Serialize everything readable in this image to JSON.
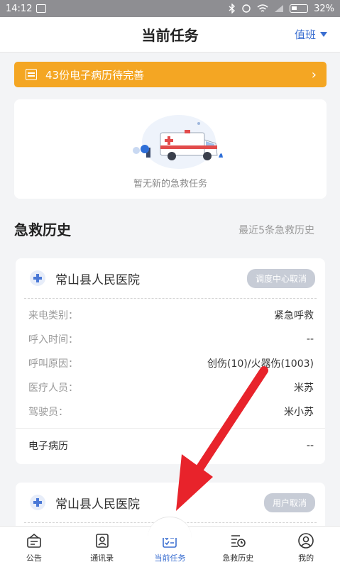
{
  "status_bar": {
    "time": "14:12",
    "battery": "32%"
  },
  "header": {
    "title": "当前任务",
    "duty_label": "值班"
  },
  "notice": {
    "text": "43份电子病历待完善"
  },
  "empty_state": {
    "text": "暂无新的急救任务"
  },
  "history": {
    "title": "急救历史",
    "subtitle": "最近5条急救历史",
    "records": [
      {
        "hospital": "常山县人民医院",
        "tag": "调度中心取消",
        "fields": [
          {
            "label": "来电类别：",
            "value": "紧急呼救"
          },
          {
            "label": "呼入时间：",
            "value": "--"
          },
          {
            "label": "呼叫原因：",
            "value": "创伤(10)/火器伤(1003)"
          },
          {
            "label": "医疗人员：",
            "value": "米苏"
          },
          {
            "label": "驾驶员：",
            "value": "米小苏"
          }
        ],
        "emr_label": "电子病历",
        "emr_value": "--"
      },
      {
        "hospital": "常山县人民医院",
        "tag": "用户取消"
      }
    ]
  },
  "tabbar": {
    "items": [
      {
        "label": "公告",
        "icon": "announcement-icon"
      },
      {
        "label": "通讯录",
        "icon": "contacts-icon"
      },
      {
        "label": "当前任务",
        "icon": "task-list-icon"
      },
      {
        "label": "急救历史",
        "icon": "history-icon"
      },
      {
        "label": "我的",
        "icon": "profile-icon"
      }
    ]
  },
  "colors": {
    "accent": "#3b6fd1",
    "notice": "#f4a623",
    "arrow": "#e8232b"
  }
}
